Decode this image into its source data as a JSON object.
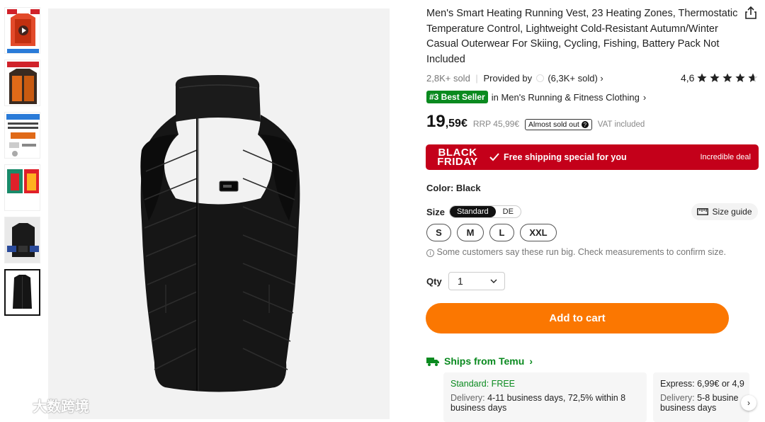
{
  "product": {
    "title": "Men's Smart Heating Running Vest, 23 Heating Zones, Thermostatic Temperature Control, Lightweight Cold-Resistant Autumn/Winter Casual Outerwear For Skiing, Cycling, Fishing, Battery Pack Not Included",
    "sold": "2,8K+ sold",
    "provided_by": "Provided by",
    "provider_sold": "(6,3K+ sold)",
    "rating": "4,6",
    "stars": 4.6,
    "best_badge": "#3 Best Seller",
    "best_category": "in Men's Running & Fitness Clothing"
  },
  "price": {
    "integer": "19",
    "decimal": ",59€",
    "rrp": "RRP 45,99€",
    "almost_sold_out": "Almost sold out",
    "vat": "VAT included"
  },
  "banner": {
    "line1": "BLACK",
    "line2": "FRIDAY",
    "free_shipping": "Free shipping special for you",
    "deal": "Incredible deal",
    "color": "#c4001a"
  },
  "options": {
    "color_label": "Color: Black",
    "size_label": "Size",
    "size_systems": [
      "Standard",
      "DE"
    ],
    "size_guide": "Size guide",
    "sizes": [
      "S",
      "M",
      "L",
      "XXL"
    ],
    "fit_note": "Some customers say these run big. Check measurements to confirm size."
  },
  "quantity": {
    "label": "Qty",
    "value": "1"
  },
  "cart_button": {
    "label": "Add to cart",
    "color": "#fb7701"
  },
  "shipping": {
    "heading": "Ships from Temu",
    "standard_title": "Standard: FREE",
    "standard_delivery_label": "Delivery:",
    "standard_delivery": "4-11 business days, 72,5% within 8 business days",
    "express_title": "Express: 6,99€ or 4,9",
    "express_delivery_label": "Delivery:",
    "express_delivery": "5-8 busine",
    "express_delivery_2": "business days"
  },
  "watermark": "大数跨境",
  "thumbnails": [
    "vest-infographic-heating-zones",
    "vest-orange-heat-zones",
    "power-supply-diagram",
    "thermal-image",
    "vest-detail",
    "vest-black-front"
  ]
}
